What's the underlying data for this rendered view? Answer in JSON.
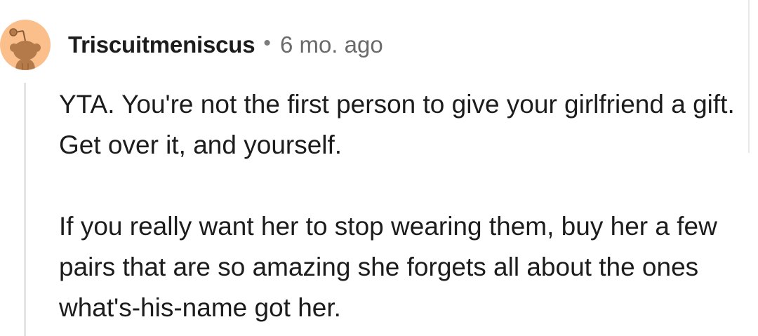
{
  "comment": {
    "username": "Triscuitmeniscus",
    "separator": "•",
    "timestamp": "6 mo. ago",
    "avatar_icon": "reddit-snoo-avatar-icon",
    "paragraphs": [
      "YTA. You're not the first person to give your girlfriend a gift. Get over it, and yourself.",
      "If you really want her to stop wearing them, buy her a few pairs that are so amazing she forgets all about the ones what's-his-name got her."
    ]
  },
  "colors": {
    "avatar_bg": "#fbbf8c",
    "avatar_figure": "#b57a4a",
    "thread_line": "#e4e4e4",
    "text": "#1c1c1c",
    "meta_text": "#6a6a6a"
  }
}
